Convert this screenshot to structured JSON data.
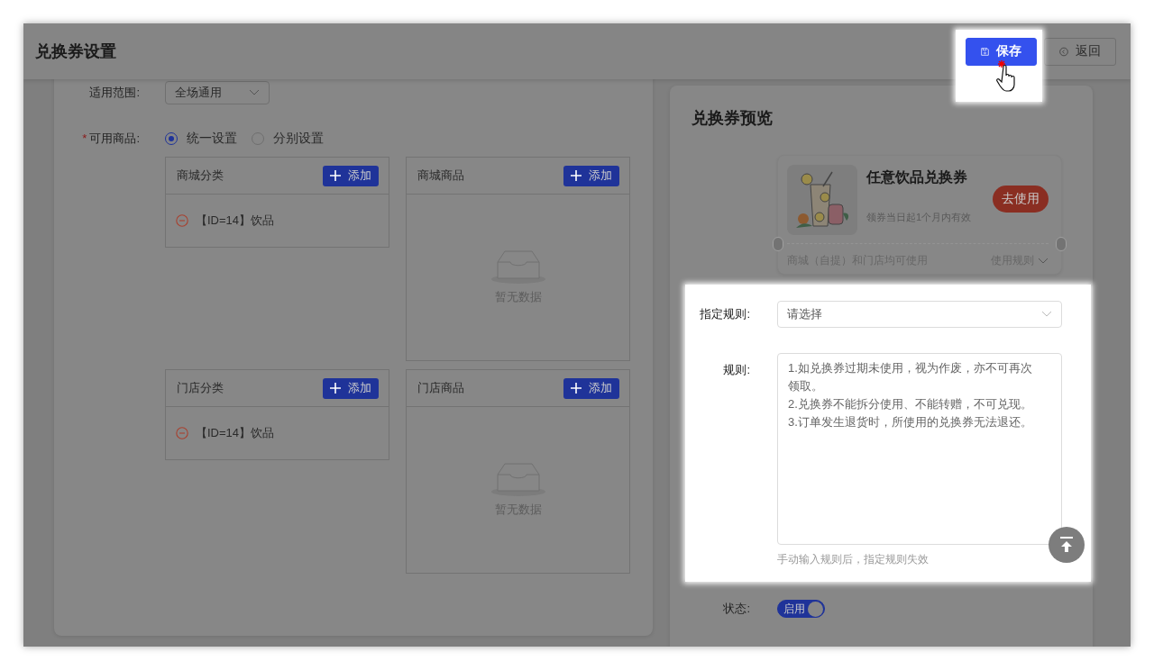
{
  "header": {
    "title": "兑换券设置",
    "buttons": [
      {
        "kind": "primary",
        "label": "保存",
        "highlighted": true
      },
      {
        "kind": "back",
        "label": "返回",
        "highlighted": false
      }
    ]
  },
  "form": {
    "scope": {
      "label": "适用范围:",
      "value": "全场通用"
    },
    "goods": {
      "label": "可用商品:",
      "required_mark": "*",
      "options": [
        {
          "label": "统一设置",
          "selected": true
        },
        {
          "label": "分别设置",
          "selected": false
        }
      ],
      "panels": [
        {
          "title": "商城分类",
          "add_label": "添加",
          "items": [
            "【ID=14】饮品"
          ]
        },
        {
          "title": "商城商品",
          "add_label": "添加",
          "empty_text": "暂无数据"
        },
        {
          "title": "门店分类",
          "add_label": "添加",
          "items": [
            "【ID=14】饮品"
          ]
        },
        {
          "title": "门店商品",
          "add_label": "添加",
          "empty_text": "暂无数据"
        }
      ]
    }
  },
  "preview": {
    "title": "兑换券预览",
    "coupon": {
      "name": "任意饮品兑换券",
      "validity": "领券当日起1个月内有效",
      "action": "去使用",
      "scope": "商城（自提）和门店均可使用",
      "rules_link": "使用规则"
    },
    "rules": {
      "highlighted": true,
      "rule_select": {
        "label": "指定规则:",
        "placeholder": "请选择"
      },
      "rule_text": {
        "label": "规则:",
        "value": "1.如兑换券过期未使用，视为作废，亦不可再次领取。\n2.兑换券不能拆分使用、不能转赠，不可兑现。\n3.订单发生退货时，所使用的兑换券无法退还。",
        "hint": "手动输入规则后，指定规则失效"
      }
    },
    "status": {
      "label": "状态:",
      "on_label": "启用",
      "on": true
    }
  }
}
